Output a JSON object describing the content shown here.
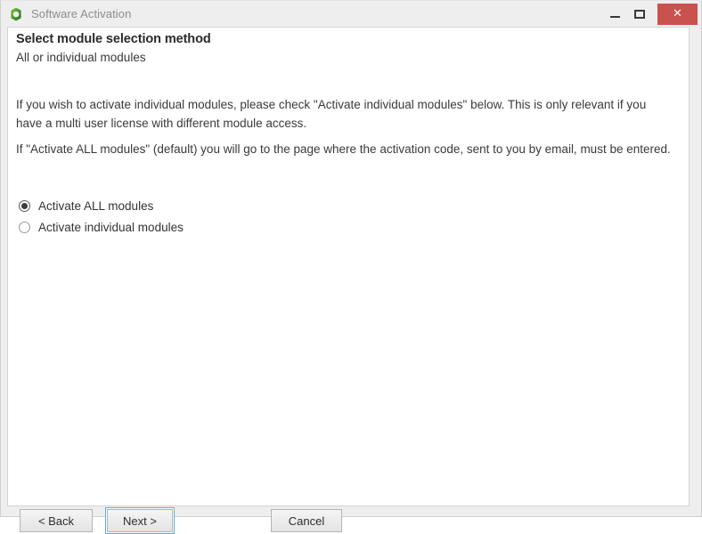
{
  "window": {
    "title": "Software Activation",
    "app_icon": "green-ring-logo-icon",
    "controls": {
      "minimize_label": "–",
      "maximize_label": "□",
      "close_label": "✕"
    },
    "accent_close_color": "#c9524f",
    "focus_border_color": "#5babe8"
  },
  "page": {
    "heading": "Select module selection method",
    "subheading": "All or individual modules",
    "paragraphs": [
      "If you wish to activate individual modules, please check \"Activate individual modules\" below. This is only relevant if you have a multi user license with different module access.",
      "If \"Activate ALL modules\" (default) you will go to the page where the activation code, sent to you by email, must be entered."
    ]
  },
  "radio_group": {
    "name": "module-selection-method",
    "options": [
      {
        "label": "Activate ALL modules",
        "checked": true
      },
      {
        "label": "Activate individual modules",
        "checked": false
      }
    ]
  },
  "footer": {
    "back_label": "< Back",
    "next_label": "Next >",
    "cancel_label": "Cancel"
  }
}
